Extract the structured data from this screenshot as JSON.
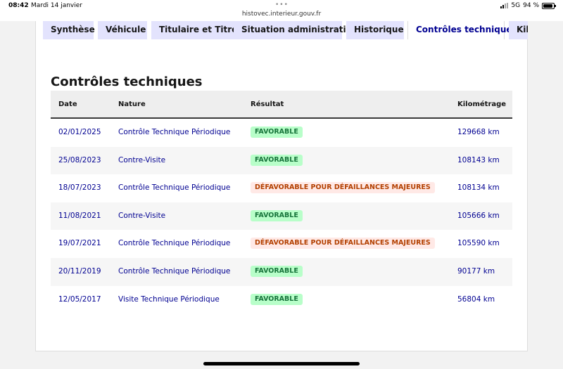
{
  "status_bar": {
    "time": "08:42",
    "date": "Mardi 14 janvier",
    "url": "histovec.interieur.gouv.fr",
    "network": "5G",
    "battery": "94 %",
    "battery_level": 0.94
  },
  "tabs": [
    {
      "label": "Synthèse"
    },
    {
      "label": "Véhicule"
    },
    {
      "label": "Titulaire et Titre"
    },
    {
      "label": "Situation administrative"
    },
    {
      "label": "Historique"
    },
    {
      "label": "Contrôles techniques",
      "active": true
    },
    {
      "label": "Kilométrage"
    }
  ],
  "section": {
    "title": "Contrôles techniques"
  },
  "table": {
    "headers": {
      "date": "Date",
      "nature": "Nature",
      "result": "Résultat",
      "mileage": "Kilométrage"
    },
    "rows": [
      {
        "date": "02/01/2025",
        "nature": "Contrôle Technique Périodique",
        "result": "FAVORABLE",
        "status": "ok",
        "mileage": "129668 km"
      },
      {
        "date": "25/08/2023",
        "nature": "Contre-Visite",
        "result": "FAVORABLE",
        "status": "ok",
        "mileage": "108143 km"
      },
      {
        "date": "18/07/2023",
        "nature": "Contrôle Technique Périodique",
        "result": "DÉFAVORABLE POUR DÉFAILLANCES MAJEURES",
        "status": "ko",
        "mileage": "108134 km"
      },
      {
        "date": "11/08/2021",
        "nature": "Contre-Visite",
        "result": "FAVORABLE",
        "status": "ok",
        "mileage": "105666 km"
      },
      {
        "date": "19/07/2021",
        "nature": "Contrôle Technique Périodique",
        "result": "DÉFAVORABLE POUR DÉFAILLANCES MAJEURES",
        "status": "ko",
        "mileage": "105590 km"
      },
      {
        "date": "20/11/2019",
        "nature": "Contrôle Technique Périodique",
        "result": "FAVORABLE",
        "status": "ok",
        "mileage": "90177 km"
      },
      {
        "date": "12/05/2017",
        "nature": "Visite Technique Périodique",
        "result": "FAVORABLE",
        "status": "ok",
        "mileage": "56804 km"
      }
    ]
  }
}
